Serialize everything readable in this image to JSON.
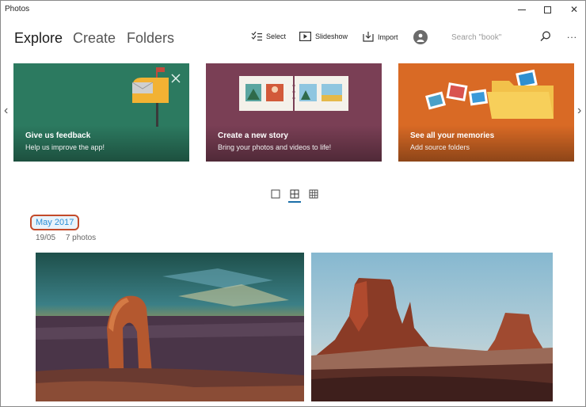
{
  "window": {
    "title": "Photos"
  },
  "nav": {
    "tabs": [
      {
        "label": "Explore",
        "active": true
      },
      {
        "label": "Create",
        "active": false
      },
      {
        "label": "Folders",
        "active": false
      }
    ],
    "tools": {
      "select": "Select",
      "slideshow": "Slideshow",
      "import": "Import"
    },
    "search_placeholder": "Search \"book\"",
    "more": "..."
  },
  "cards": [
    {
      "title": "Give us feedback",
      "subtitle": "Help us improve the app!",
      "color": "#2c7a60"
    },
    {
      "title": "Create a new story",
      "subtitle": "Bring your photos and videos to life!",
      "color": "#7a3f55"
    },
    {
      "title": "See all your memories",
      "subtitle": "Add source folders",
      "color": "#d96a25"
    }
  ],
  "group": {
    "title": "May 2017",
    "date": "19/05",
    "count": "7 photos"
  },
  "colors": {
    "accent": "#2b8fd6",
    "highlight_border": "#c44a2a"
  }
}
